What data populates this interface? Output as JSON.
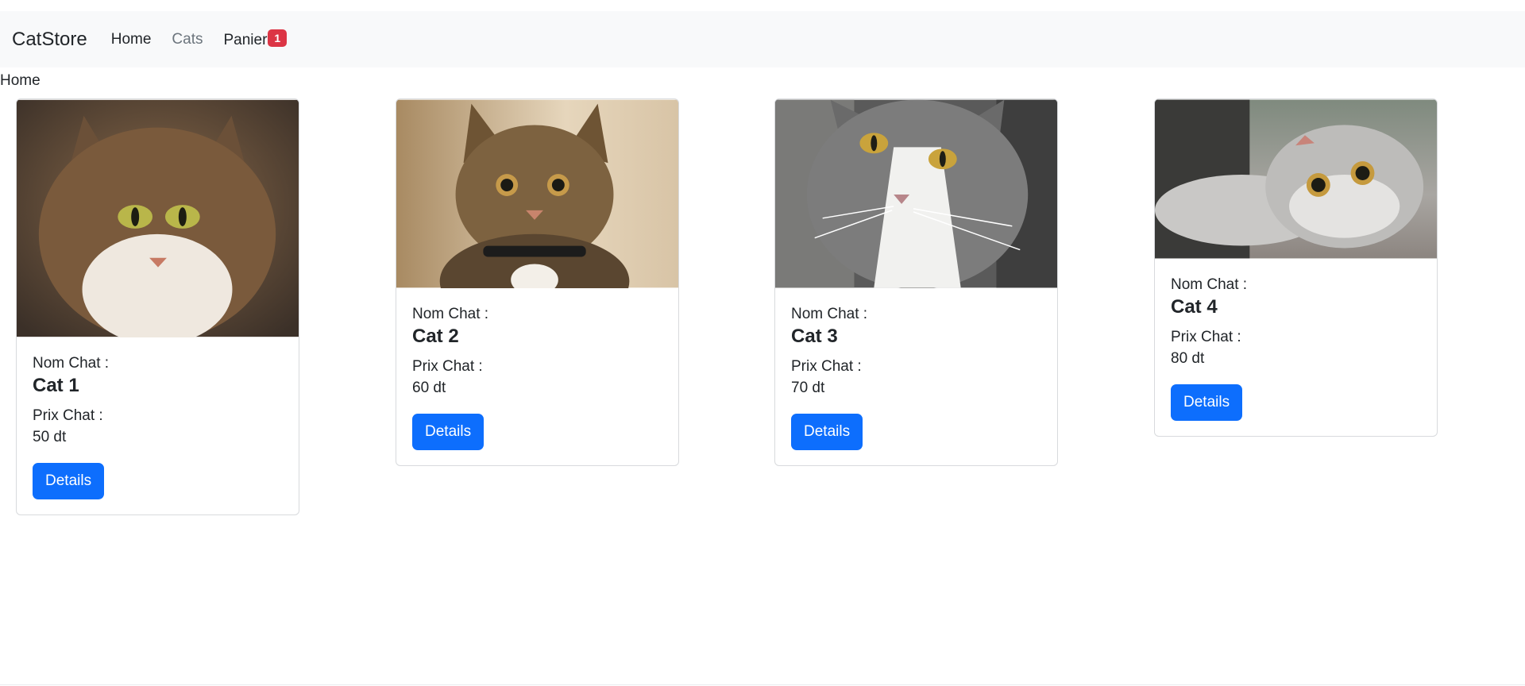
{
  "navbar": {
    "brand": "CatStore",
    "links": [
      {
        "label": "Home"
      },
      {
        "label": "Cats"
      },
      {
        "label": "Panier"
      }
    ],
    "cart_count": "1"
  },
  "breadcrumb": "Home",
  "colors": {
    "primary": "#0d6efd",
    "badge": "#dc3545",
    "navbar_bg": "#f8f9fa"
  },
  "cards": [
    {
      "name_label": "Nom Chat :",
      "name": "Cat 1",
      "price_label": "Prix Chat :",
      "price": "50 dt",
      "button": "Details"
    },
    {
      "name_label": "Nom Chat :",
      "name": "Cat 2",
      "price_label": "Prix Chat :",
      "price": "60 dt",
      "button": "Details"
    },
    {
      "name_label": "Nom Chat :",
      "name": "Cat 3",
      "price_label": "Prix Chat :",
      "price": "70 dt",
      "button": "Details"
    },
    {
      "name_label": "Nom Chat :",
      "name": "Cat 4",
      "price_label": "Prix Chat :",
      "price": "80 dt",
      "button": "Details"
    }
  ]
}
